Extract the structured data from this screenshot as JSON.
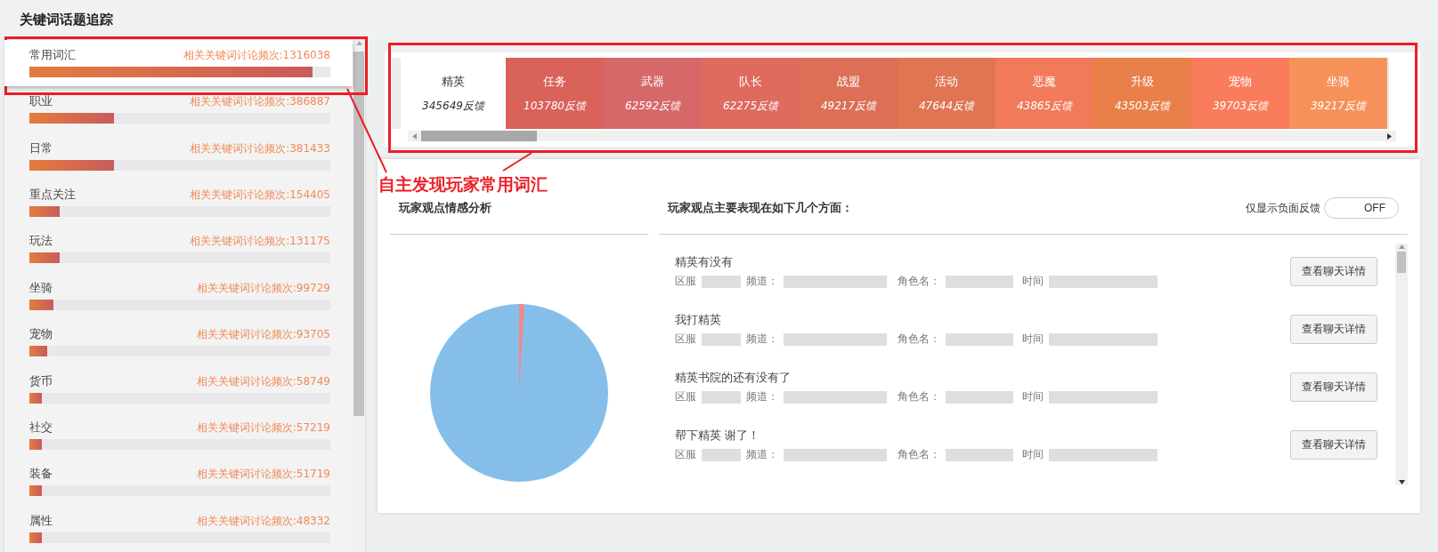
{
  "page_title": "关键词话题追踪",
  "keywords": [
    {
      "name": "常用词汇",
      "count": "相关关键词讨论频次:1316038",
      "level": 0.94,
      "selected": true
    },
    {
      "name": "职业",
      "count": "相关关键词讨论频次:386887",
      "level": 0.28,
      "selected": false
    },
    {
      "name": "日常",
      "count": "相关关键词讨论频次:381433",
      "level": 0.28,
      "selected": false
    },
    {
      "name": "重点关注",
      "count": "相关关键词讨论频次:154405",
      "level": 0.1,
      "selected": false
    },
    {
      "name": "玩法",
      "count": "相关关键词讨论频次:131175",
      "level": 0.1,
      "selected": false
    },
    {
      "name": "坐骑",
      "count": "相关关键词讨论频次:99729",
      "level": 0.08,
      "selected": false
    },
    {
      "name": "宠物",
      "count": "相关关键词讨论频次:93705",
      "level": 0.06,
      "selected": false
    },
    {
      "name": "货币",
      "count": "相关关键词讨论频次:58749",
      "level": 0.04,
      "selected": false
    },
    {
      "name": "社交",
      "count": "相关关键词讨论频次:57219",
      "level": 0.04,
      "selected": false
    },
    {
      "name": "装备",
      "count": "相关关键词讨论频次:51719",
      "level": 0.04,
      "selected": false
    },
    {
      "name": "属性",
      "count": "相关关键词讨论频次:48332",
      "level": 0.04,
      "selected": false
    }
  ],
  "tabs": [
    {
      "label": "精英",
      "count": "345649反馈",
      "selected": true
    },
    {
      "label": "任务",
      "count": "103780反馈",
      "selected": false,
      "color": "#d9625a"
    },
    {
      "label": "武器",
      "count": "62592反馈",
      "selected": false,
      "color": "#d76869"
    },
    {
      "label": "队长",
      "count": "62275反馈",
      "selected": false,
      "color": "#df6a5e"
    },
    {
      "label": "战盟",
      "count": "49217反馈",
      "selected": false,
      "color": "#dc6f55"
    },
    {
      "label": "活动",
      "count": "47644反馈",
      "selected": false,
      "color": "#df7553"
    },
    {
      "label": "恶魔",
      "count": "43865反馈",
      "selected": false,
      "color": "#f07a5a"
    },
    {
      "label": "升级",
      "count": "43503反馈",
      "selected": false,
      "color": "#e9804a"
    },
    {
      "label": "宠物",
      "count": "39703反馈",
      "selected": false,
      "color": "#f97d5d"
    },
    {
      "label": "坐骑",
      "count": "39217反馈",
      "selected": false,
      "color": "#f69259"
    }
  ],
  "sentiment": {
    "title": "玩家观点情感分析"
  },
  "opinions": {
    "title": "玩家观点主要表现在如下几个方面：",
    "filter_label": "仅显示负面反馈",
    "filter_toggle": {
      "on": false,
      "label": "OFF"
    },
    "items": [
      {
        "text": "精英有没有",
        "server_label": "区服",
        "channel_label": "频道：",
        "role_label": "角色名：",
        "time_label": "时间",
        "button": "查看聊天详情"
      },
      {
        "text": "我打精英",
        "server_label": "区服",
        "channel_label": "频道：",
        "role_label": "角色名：",
        "time_label": "时间",
        "button": "查看聊天详情"
      },
      {
        "text": "精英书院的还有没有了",
        "server_label": "区服",
        "channel_label": "频道：",
        "role_label": "角色名：",
        "time_label": "时间",
        "button": "查看聊天详情"
      },
      {
        "text": "帮下精英 谢了！",
        "server_label": "区服",
        "channel_label": "频道：",
        "role_label": "角色名：",
        "time_label": "时间",
        "button": "查看聊天详情"
      }
    ]
  },
  "annotation": {
    "text": "自主发现玩家常用词汇"
  }
}
